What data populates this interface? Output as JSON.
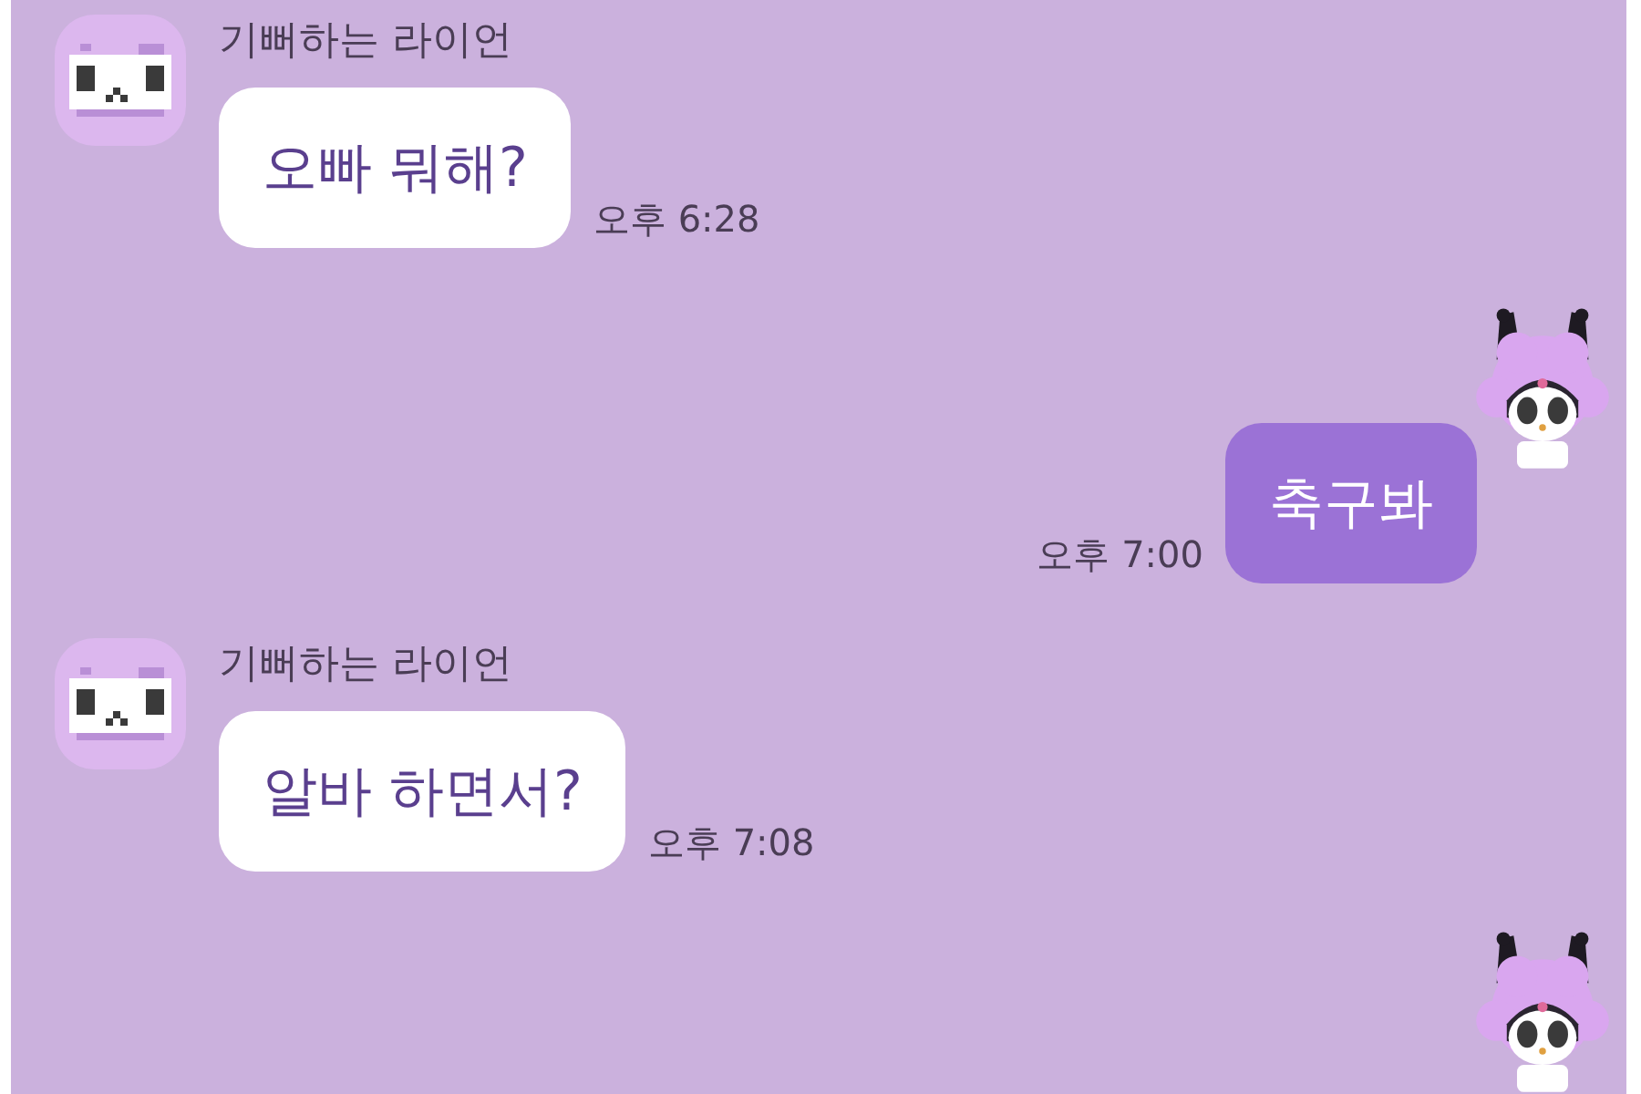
{
  "messages": [
    {
      "kind": "incoming",
      "sender": "기뻐하는 라이언",
      "text": "오빠 뭐해?",
      "time": "오후 6:28"
    },
    {
      "kind": "outgoing",
      "text": "축구봐",
      "time": "오후 7:00"
    },
    {
      "kind": "incoming",
      "sender": "기뻐하는 라이언",
      "text": "알바 하면서?",
      "time": "오후 7:08"
    },
    {
      "kind": "outgoing_avatar"
    }
  ]
}
